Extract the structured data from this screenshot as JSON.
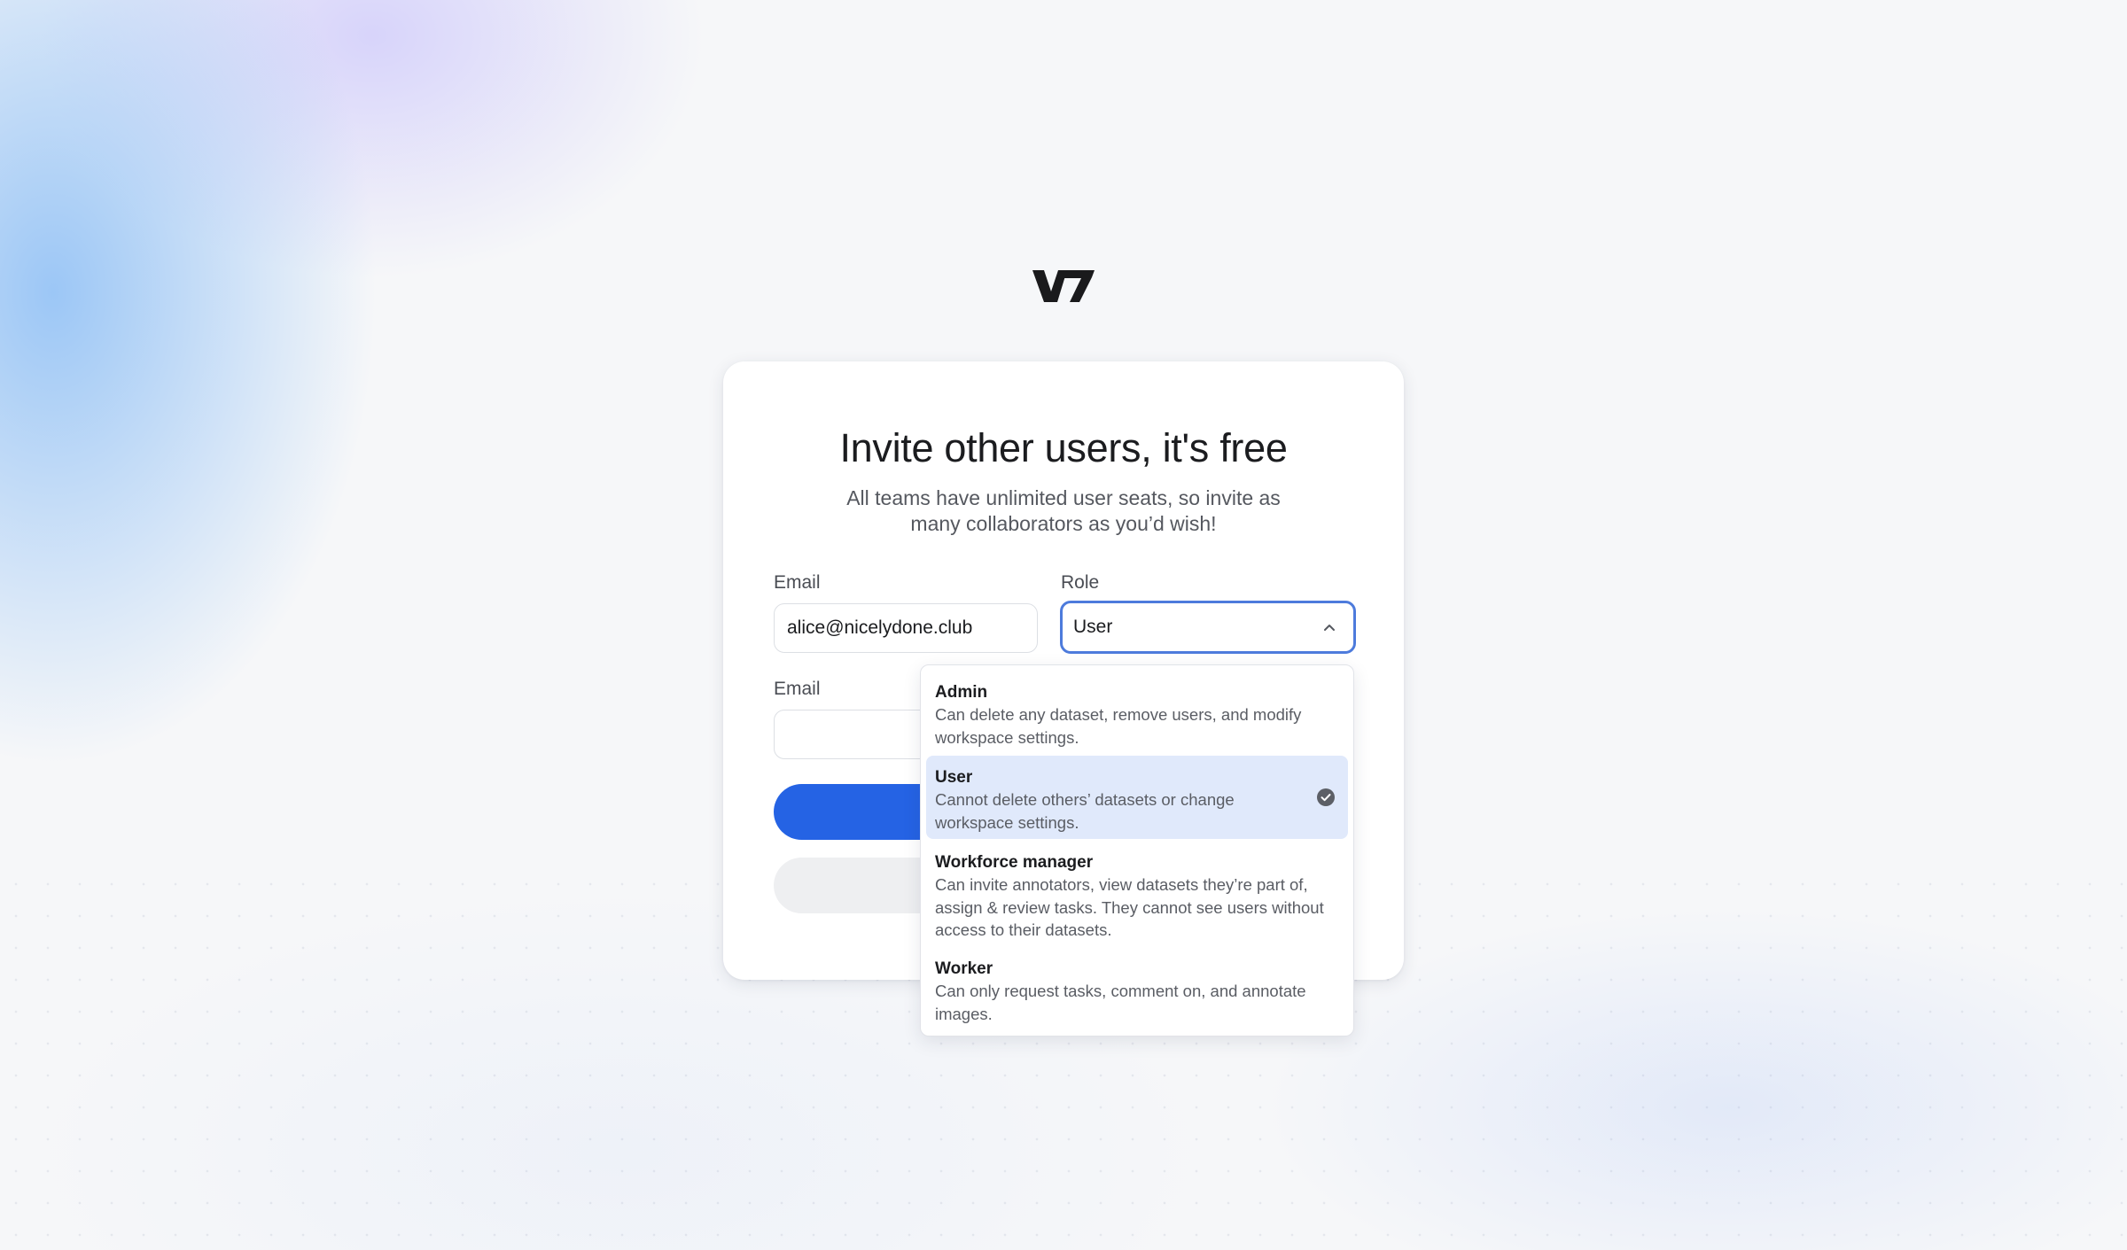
{
  "brand": {
    "logo_text": "V7"
  },
  "invite": {
    "title": "Invite other users, it's free",
    "subtitle": "All teams have unlimited user seats, so invite as many collaborators as you’d wish!",
    "row1": {
      "email_label": "Email",
      "email_value": "alice@nicelydone.club",
      "role_label": "Role",
      "role_value": "User"
    },
    "row2": {
      "email_label": "Email",
      "email_value": ""
    }
  },
  "role_dropdown": {
    "options": [
      {
        "name": "Admin",
        "description": "Can delete any dataset, remove users, and modify workspace settings."
      },
      {
        "name": "User",
        "description": "Cannot delete others’ datasets or change workspace settings.",
        "selected": true
      },
      {
        "name": "Workforce manager",
        "description": "Can invite annotators, view datasets they’re part of, assign & review tasks. They cannot see users without access to their datasets."
      },
      {
        "name": "Worker",
        "description": "Can only request tasks, comment on, and annotate images."
      }
    ]
  },
  "colors": {
    "primary": "#2563e4",
    "focus_border": "#4d7bdc",
    "selected_option_bg": "#e0e9fb",
    "secondary_button": "#eeeff1"
  },
  "icons": {
    "role_select": "chevron-up-icon",
    "selected_option": "check-circle-icon"
  }
}
